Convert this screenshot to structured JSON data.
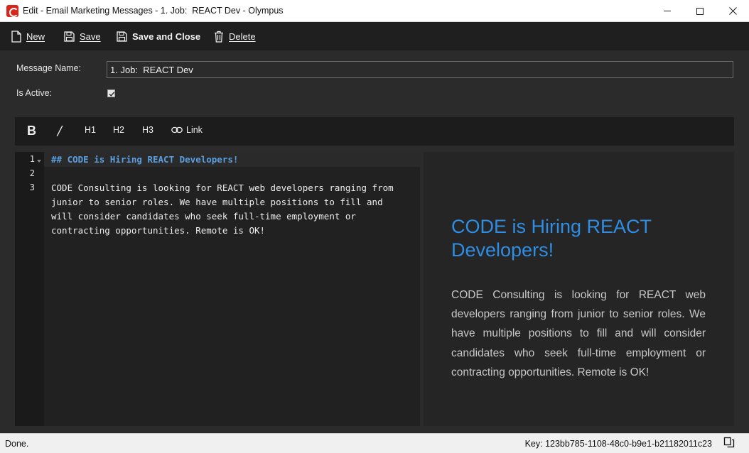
{
  "window": {
    "title": "Edit - Email Marketing Messages - 1. Job:  REACT Dev - Olympus"
  },
  "toolbar": {
    "new_label": "New",
    "save_label": "Save",
    "save_close_label": "Save and Close",
    "delete_label": "Delete"
  },
  "form": {
    "message_name_label": "Message Name:",
    "message_name_value": "1. Job:  REACT Dev",
    "is_active_label": "Is Active:",
    "is_active_checked": true
  },
  "format_bar": {
    "bold": "B",
    "italic": "/",
    "h1": "H1",
    "h2": "H2",
    "h3": "H3",
    "link": "Link"
  },
  "editor": {
    "line_numbers": [
      "1",
      "2",
      "3"
    ],
    "lines": [
      "## CODE is Hiring REACT Developers!",
      "",
      "CODE Consulting is looking for REACT web developers ranging from\njunior to senior roles. We have multiple positions to fill and\nwill consider candidates who seek full-time employment or\ncontracting opportunities. Remote is OK!"
    ]
  },
  "preview": {
    "heading": "CODE is Hiring REACT Developers!",
    "body": "CODE Consulting is looking for REACT web developers ranging from junior to senior roles. We have multiple positions to fill and will consider candidates who seek full-time employment or contracting opportunities. Remote is OK!"
  },
  "status": {
    "text": "Done.",
    "key": "Key: 123bb785-1108-48c0-b9e1-b21182011c23"
  },
  "colors": {
    "accent": "#2f8de4",
    "heading_code": "#5b9fe0",
    "app_icon": "#d9261c"
  }
}
